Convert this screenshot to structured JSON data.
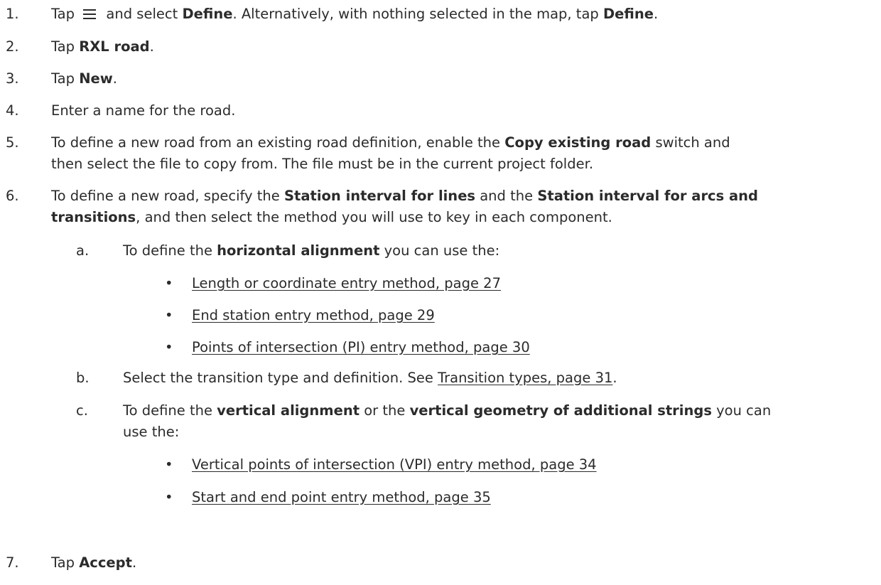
{
  "steps": [
    {
      "n": "1.",
      "parts": [
        "Tap",
        "and select",
        "Define",
        ". Alternatively, with nothing selected in the map, tap",
        "Define",
        "."
      ],
      "icon": "menu-icon"
    },
    {
      "n": "2.",
      "parts": [
        "Tap",
        "RXL road",
        "."
      ]
    },
    {
      "n": "3.",
      "parts": [
        "Tap",
        "New",
        "."
      ]
    },
    {
      "n": "4.",
      "parts": [
        "Enter a name for the road."
      ]
    },
    {
      "n": "5.",
      "parts": [
        "To define a new road from an existing road definition, enable the",
        "Copy existing road",
        "switch and",
        "then select the file to copy from. The file must be in the current project folder."
      ]
    },
    {
      "n": "6.",
      "parts": [
        "To define a new road, specify the",
        "Station interval for lines",
        "and the",
        "Station interval for arcs and",
        "transitions",
        ", and then select the method you will use to key in each component."
      ]
    },
    {
      "n": "7.",
      "parts": [
        "Tap",
        "Accept",
        "."
      ]
    }
  ],
  "substeps": [
    {
      "n": "a.",
      "parts": [
        "To define the",
        "horizontal alignment",
        "you can use the:"
      ],
      "links": [
        "Length or coordinate entry method, page 27",
        "End station entry method, page 29",
        "Points of intersection (PI) entry method, page 30"
      ]
    },
    {
      "n": "b.",
      "parts": [
        "Select the transition type and definition. See",
        "Transition types, page 31",
        "."
      ]
    },
    {
      "n": "c.",
      "parts": [
        "To define the",
        "vertical alignment",
        "or the",
        "vertical geometry of additional strings",
        "you can",
        "use the:"
      ],
      "links": [
        "Vertical points of intersection (VPI) entry method, page 34",
        "Start and end point entry method, page 35"
      ]
    }
  ],
  "bullet_char": "•"
}
